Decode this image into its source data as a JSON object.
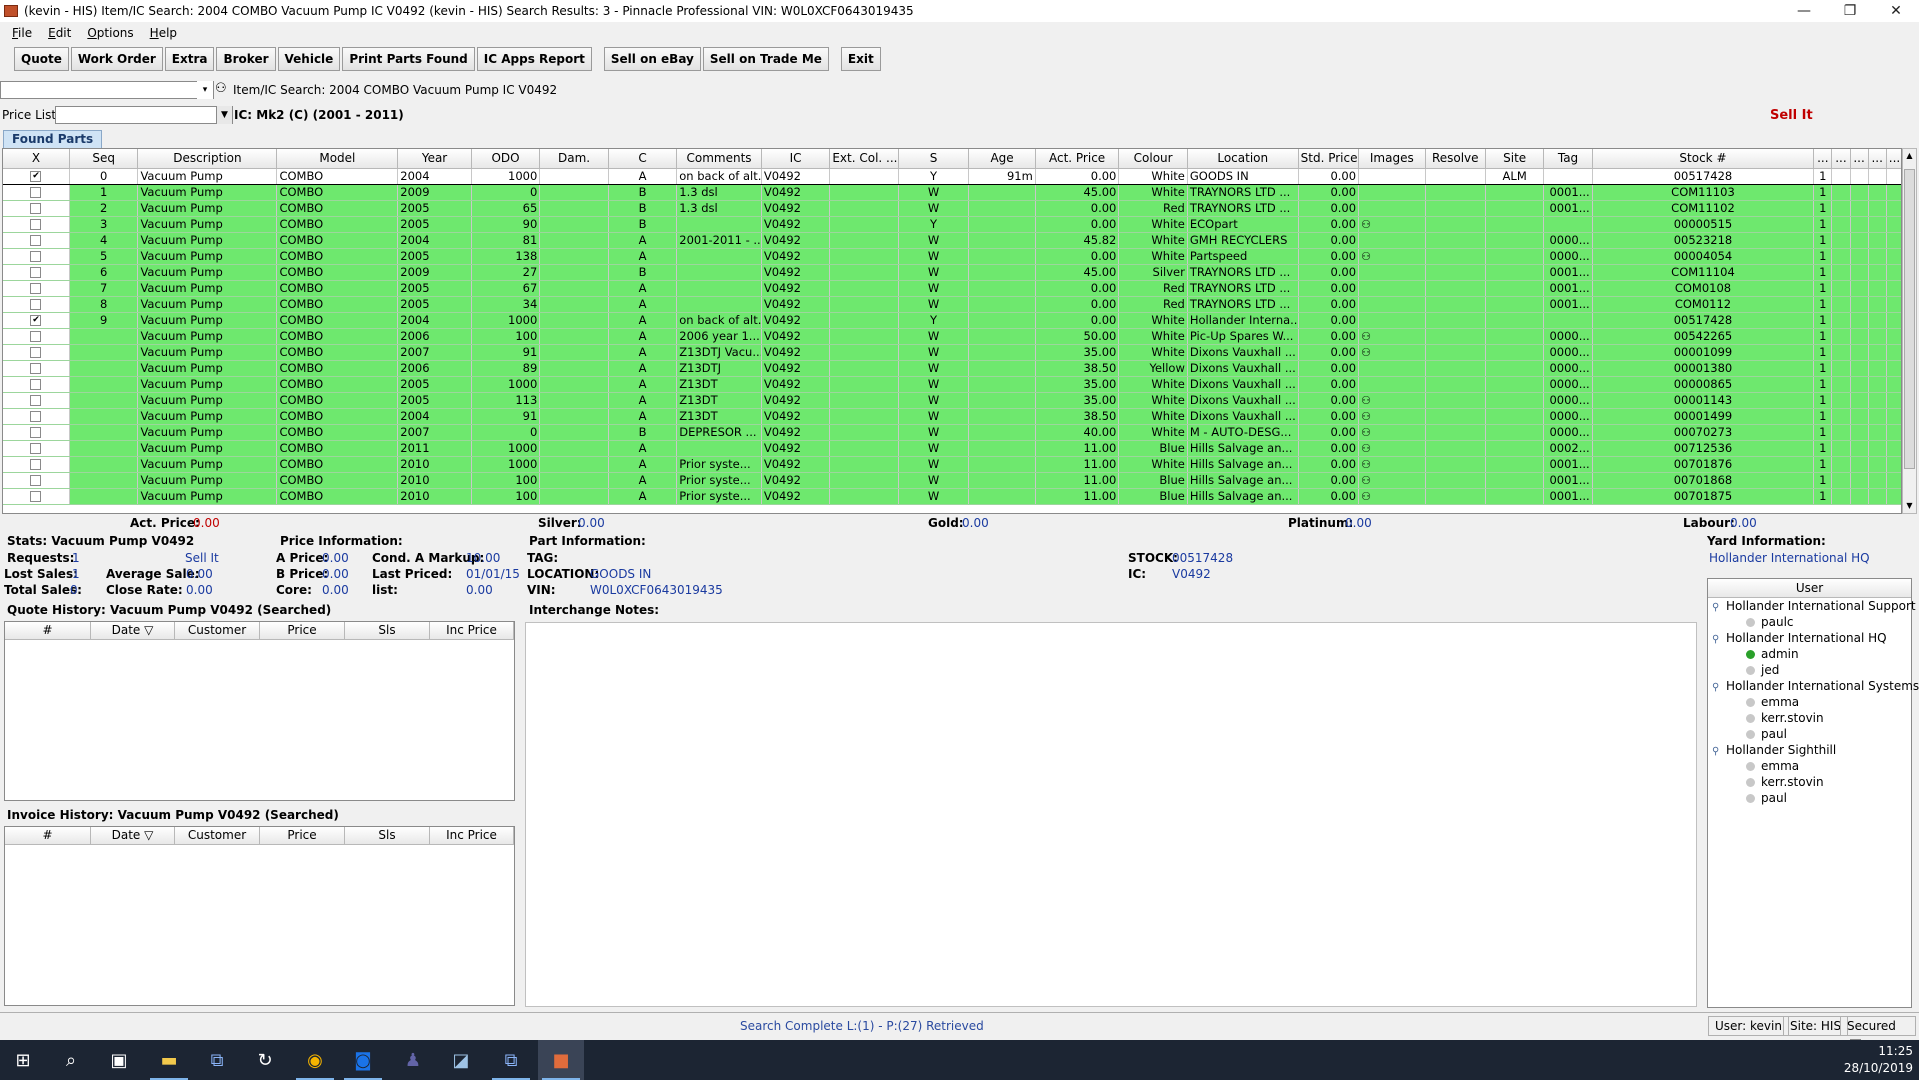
{
  "window": {
    "title": "(kevin - HIS) Item/IC Search: 2004 COMBO Vacuum Pump  IC V0492   (kevin - HIS) Search Results: 3 - Pinnacle Professional VIN: W0L0XCF0643019435",
    "minimize": "—",
    "restore": "❐",
    "close": "✕"
  },
  "menu": [
    "File",
    "Edit",
    "Options",
    "Help"
  ],
  "toolbar": [
    "Quote",
    "Work Order",
    "Extra",
    "Broker",
    "Vehicle",
    "Print Parts Found",
    "IC Apps Report",
    "Sell on eBay",
    "Sell on Trade Me",
    "Exit"
  ],
  "search": {
    "item_ic": "Item/IC Search: 2004 COMBO Vacuum Pump  IC V0492",
    "price_list_label": "Price List",
    "ic_label": "IC: Mk2 (C) (2001 - 2011)",
    "sell_it": "Sell It"
  },
  "tab": "Found Parts",
  "grid": {
    "headers": [
      "X",
      "Seq",
      "Description",
      "Model",
      "Year",
      "ODO",
      "Dam.",
      "C",
      "Comments",
      "IC",
      "Ext. Col. ...",
      "S",
      "Age",
      "Act. Price",
      "Colour",
      "Location",
      "Std. Price",
      "Images",
      "Resolve",
      "Site",
      "Tag",
      "Stock #",
      "...",
      "...",
      "...",
      "...",
      "..."
    ],
    "rows": [
      {
        "chk": true,
        "seq": "0",
        "desc": "Vacuum Pump",
        "model": "COMBO",
        "year": "2004",
        "odo": "1000",
        "c": "A",
        "comm": "on back of alt...",
        "ic": "V0492",
        "s": "Y",
        "age": "91m",
        "price": "0.00",
        "colour": "White",
        "loc": "GOODS IN",
        "std": "0.00",
        "img": false,
        "site": "ALM",
        "tag": "",
        "stock": "00517428",
        "q": "1",
        "sel": true
      },
      {
        "chk": false,
        "seq": "1",
        "desc": "Vacuum Pump",
        "model": "COMBO",
        "year": "2009",
        "odo": "0",
        "c": "B",
        "comm": "1.3 dsl",
        "ic": "V0492",
        "s": "W",
        "age": "",
        "price": "45.00",
        "colour": "White",
        "loc": "TRAYNORS LTD ...",
        "std": "0.00",
        "img": false,
        "site": "",
        "tag": "0001...",
        "stock": "COM11103",
        "q": "1"
      },
      {
        "chk": false,
        "seq": "2",
        "desc": "Vacuum Pump",
        "model": "COMBO",
        "year": "2005",
        "odo": "65",
        "c": "B",
        "comm": "1.3 dsl",
        "ic": "V0492",
        "s": "W",
        "age": "",
        "price": "0.00",
        "colour": "Red",
        "loc": "TRAYNORS LTD ...",
        "std": "0.00",
        "img": false,
        "site": "",
        "tag": "0001...",
        "stock": "COM11102",
        "q": "1"
      },
      {
        "chk": false,
        "seq": "3",
        "desc": "Vacuum Pump",
        "model": "COMBO",
        "year": "2005",
        "odo": "90",
        "c": "B",
        "comm": "",
        "ic": "V0492",
        "s": "Y",
        "age": "",
        "price": "0.00",
        "colour": "White",
        "loc": "ECOpart",
        "std": "0.00",
        "img": true,
        "site": "",
        "tag": "",
        "stock": "00000515",
        "q": "1"
      },
      {
        "chk": false,
        "seq": "4",
        "desc": "Vacuum Pump",
        "model": "COMBO",
        "year": "2004",
        "odo": "81",
        "c": "A",
        "comm": "2001-2011 - ...",
        "ic": "V0492",
        "s": "W",
        "age": "",
        "price": "45.82",
        "colour": "White",
        "loc": "GMH RECYCLERS",
        "std": "0.00",
        "img": false,
        "site": "",
        "tag": "0000...",
        "stock": "00523218",
        "q": "1"
      },
      {
        "chk": false,
        "seq": "5",
        "desc": "Vacuum Pump",
        "model": "COMBO",
        "year": "2005",
        "odo": "138",
        "c": "A",
        "comm": "",
        "ic": "V0492",
        "s": "W",
        "age": "",
        "price": "0.00",
        "colour": "White",
        "loc": "Partspeed",
        "std": "0.00",
        "img": true,
        "site": "",
        "tag": "0000...",
        "stock": "00004054",
        "q": "1"
      },
      {
        "chk": false,
        "seq": "6",
        "desc": "Vacuum Pump",
        "model": "COMBO",
        "year": "2009",
        "odo": "27",
        "c": "B",
        "comm": "",
        "ic": "V0492",
        "s": "W",
        "age": "",
        "price": "45.00",
        "colour": "Silver",
        "loc": "TRAYNORS LTD ...",
        "std": "0.00",
        "img": false,
        "site": "",
        "tag": "0001...",
        "stock": "COM11104",
        "q": "1"
      },
      {
        "chk": false,
        "seq": "7",
        "desc": "Vacuum Pump",
        "model": "COMBO",
        "year": "2005",
        "odo": "67",
        "c": "A",
        "comm": "",
        "ic": "V0492",
        "s": "W",
        "age": "",
        "price": "0.00",
        "colour": "Red",
        "loc": "TRAYNORS LTD ...",
        "std": "0.00",
        "img": false,
        "site": "",
        "tag": "0001...",
        "stock": "COM0108",
        "q": "1"
      },
      {
        "chk": false,
        "seq": "8",
        "desc": "Vacuum Pump",
        "model": "COMBO",
        "year": "2005",
        "odo": "34",
        "c": "A",
        "comm": "",
        "ic": "V0492",
        "s": "W",
        "age": "",
        "price": "0.00",
        "colour": "Red",
        "loc": "TRAYNORS LTD ...",
        "std": "0.00",
        "img": false,
        "site": "",
        "tag": "0001...",
        "stock": "COM0112",
        "q": "1"
      },
      {
        "chk": true,
        "seq": "9",
        "desc": "Vacuum Pump",
        "model": "COMBO",
        "year": "2004",
        "odo": "1000",
        "c": "A",
        "comm": "on back of alt...",
        "ic": "V0492",
        "s": "Y",
        "age": "",
        "price": "0.00",
        "colour": "White",
        "loc": "Hollander Interna...",
        "std": "0.00",
        "img": false,
        "site": "",
        "tag": "",
        "stock": "00517428",
        "q": "1"
      },
      {
        "chk": false,
        "seq": "",
        "desc": "Vacuum Pump",
        "model": "COMBO",
        "year": "2006",
        "odo": "100",
        "c": "A",
        "comm": "2006 year 1....",
        "ic": "V0492",
        "s": "W",
        "age": "",
        "price": "50.00",
        "colour": "White",
        "loc": "Pic-Up Spares W...",
        "std": "0.00",
        "img": true,
        "site": "",
        "tag": "0000...",
        "stock": "00542265",
        "q": "1"
      },
      {
        "chk": false,
        "seq": "",
        "desc": "Vacuum Pump",
        "model": "COMBO",
        "year": "2007",
        "odo": "91",
        "c": "A",
        "comm": "Z13DTJ Vacu...",
        "ic": "V0492",
        "s": "W",
        "age": "",
        "price": "35.00",
        "colour": "White",
        "loc": "Dixons Vauxhall ...",
        "std": "0.00",
        "img": true,
        "site": "",
        "tag": "0000...",
        "stock": "00001099",
        "q": "1"
      },
      {
        "chk": false,
        "seq": "",
        "desc": "Vacuum Pump",
        "model": "COMBO",
        "year": "2006",
        "odo": "89",
        "c": "A",
        "comm": "Z13DTJ",
        "ic": "V0492",
        "s": "W",
        "age": "",
        "price": "38.50",
        "colour": "Yellow",
        "loc": "Dixons Vauxhall ...",
        "std": "0.00",
        "img": false,
        "site": "",
        "tag": "0000...",
        "stock": "00001380",
        "q": "1"
      },
      {
        "chk": false,
        "seq": "",
        "desc": "Vacuum Pump",
        "model": "COMBO",
        "year": "2005",
        "odo": "1000",
        "c": "A",
        "comm": "Z13DT",
        "ic": "V0492",
        "s": "W",
        "age": "",
        "price": "35.00",
        "colour": "White",
        "loc": "Dixons Vauxhall ...",
        "std": "0.00",
        "img": false,
        "site": "",
        "tag": "0000...",
        "stock": "00000865",
        "q": "1"
      },
      {
        "chk": false,
        "seq": "",
        "desc": "Vacuum Pump",
        "model": "COMBO",
        "year": "2005",
        "odo": "113",
        "c": "A",
        "comm": "Z13DT",
        "ic": "V0492",
        "s": "W",
        "age": "",
        "price": "35.00",
        "colour": "White",
        "loc": "Dixons Vauxhall ...",
        "std": "0.00",
        "img": true,
        "site": "",
        "tag": "0000...",
        "stock": "00001143",
        "q": "1"
      },
      {
        "chk": false,
        "seq": "",
        "desc": "Vacuum Pump",
        "model": "COMBO",
        "year": "2004",
        "odo": "91",
        "c": "A",
        "comm": "Z13DT",
        "ic": "V0492",
        "s": "W",
        "age": "",
        "price": "38.50",
        "colour": "White",
        "loc": "Dixons Vauxhall ...",
        "std": "0.00",
        "img": true,
        "site": "",
        "tag": "0000...",
        "stock": "00001499",
        "q": "1"
      },
      {
        "chk": false,
        "seq": "",
        "desc": "Vacuum Pump",
        "model": "COMBO",
        "year": "2007",
        "odo": "0",
        "c": "B",
        "comm": "DEPRESOR ...",
        "ic": "V0492",
        "s": "W",
        "age": "",
        "price": "40.00",
        "colour": "White",
        "loc": "M  - AUTO-DESG...",
        "std": "0.00",
        "img": true,
        "site": "",
        "tag": "0000...",
        "stock": "00070273",
        "q": "1"
      },
      {
        "chk": false,
        "seq": "",
        "desc": "Vacuum Pump",
        "model": "COMBO",
        "year": "2011",
        "odo": "1000",
        "c": "A",
        "comm": "",
        "ic": "V0492",
        "s": "W",
        "age": "",
        "price": "11.00",
        "colour": "Blue",
        "loc": "Hills Salvage an...",
        "std": "0.00",
        "img": true,
        "site": "",
        "tag": "0002...",
        "stock": "00712536",
        "q": "1"
      },
      {
        "chk": false,
        "seq": "",
        "desc": "Vacuum Pump",
        "model": "COMBO",
        "year": "2010",
        "odo": "1000",
        "c": "A",
        "comm": "Prior syste...",
        "ic": "V0492",
        "s": "W",
        "age": "",
        "price": "11.00",
        "colour": "White",
        "loc": "Hills Salvage an...",
        "std": "0.00",
        "img": true,
        "site": "",
        "tag": "0001...",
        "stock": "00701876",
        "q": "1"
      },
      {
        "chk": false,
        "seq": "",
        "desc": "Vacuum Pump",
        "model": "COMBO",
        "year": "2010",
        "odo": "100",
        "c": "A",
        "comm": "Prior syste...",
        "ic": "V0492",
        "s": "W",
        "age": "",
        "price": "11.00",
        "colour": "Blue",
        "loc": "Hills Salvage an...",
        "std": "0.00",
        "img": true,
        "site": "",
        "tag": "0001...",
        "stock": "00701868",
        "q": "1"
      },
      {
        "chk": false,
        "seq": "",
        "desc": "Vacuum Pump",
        "model": "COMBO",
        "year": "2010",
        "odo": "100",
        "c": "A",
        "comm": "Prior syste...",
        "ic": "V0492",
        "s": "W",
        "age": "",
        "price": "11.00",
        "colour": "Blue",
        "loc": "Hills Salvage an...",
        "std": "0.00",
        "img": true,
        "site": "",
        "tag": "0001...",
        "stock": "00701875",
        "q": "1"
      }
    ]
  },
  "prices": {
    "act_label": "Act. Price:",
    "act": "0.00",
    "silver_label": "Silver:",
    "silver": "0.00",
    "gold_label": "Gold:",
    "gold": "0.00",
    "platinum_label": "Platinum:",
    "platinum": "0.00",
    "labour_label": "Labour:",
    "labour": "0.00"
  },
  "stats": {
    "title": "Stats: Vacuum Pump V0492",
    "requests_label": "Requests:",
    "requests": "1",
    "sell_it": "Sell It",
    "lost_label": "Lost Sales:",
    "lost": "1",
    "avg_label": "Average Sale:",
    "avg": "0.00",
    "total_label": "Total Sales:",
    "total": "0",
    "close_label": "Close Rate:",
    "close": "0.00"
  },
  "price_info": {
    "title": "Price Information:",
    "a_label": "A Price:",
    "a": "0.00",
    "cond_label": "Cond. A Markup:",
    "cond": "10.00",
    "b_label": "B Price:",
    "b": "0.00",
    "last_label": "Last Priced:",
    "last": "01/01/15",
    "core_label": "Core:",
    "core": "0.00",
    "list_label": "list:",
    "list": "0.00"
  },
  "part_info": {
    "title": "Part Information:",
    "tag_label": "TAG:",
    "tag": "",
    "loc_label": "LOCATION:",
    "loc": "GOODS IN",
    "vin_label": "VIN:",
    "vin": "W0L0XCF0643019435",
    "stock_label": "STOCK:",
    "stock": "00517428",
    "ic_label": "IC:",
    "ic": "V0492"
  },
  "quote_history": {
    "title": "Quote History: Vacuum Pump V0492 (Searched)",
    "headers": [
      "#",
      "Date ▽",
      "Customer",
      "Price",
      "Sls",
      "Inc Price"
    ]
  },
  "invoice_history": {
    "title": "Invoice History: Vacuum Pump V0492 (Searched)",
    "headers": [
      "#",
      "Date ▽",
      "Customer",
      "Price",
      "Sls",
      "Inc Price"
    ]
  },
  "interchange": {
    "title": "Interchange Notes:"
  },
  "yard": {
    "title": "Yard Information:",
    "selected": "Hollander International HQ",
    "user_header": "User",
    "groups": [
      {
        "name": "Hollander International Support",
        "users": [
          {
            "name": "paulc",
            "online": false
          }
        ]
      },
      {
        "name": "Hollander International HQ",
        "users": [
          {
            "name": "admin",
            "online": true
          },
          {
            "name": "jed",
            "online": false
          }
        ]
      },
      {
        "name": "Hollander International Systems...",
        "users": [
          {
            "name": "emma",
            "online": false
          },
          {
            "name": "kerr.stovin",
            "online": false
          },
          {
            "name": "paul",
            "online": false
          }
        ]
      },
      {
        "name": "Hollander Sighthill",
        "users": [
          {
            "name": "emma",
            "online": false
          },
          {
            "name": "kerr.stovin",
            "online": false
          },
          {
            "name": "paul",
            "online": false
          }
        ]
      }
    ]
  },
  "status": {
    "text": "Search Complete L:(1) - P:(27) Retrieved",
    "user": "User: kevin",
    "site": "Site: HIS",
    "secured": "Secured"
  },
  "clock": {
    "time": "11:25",
    "date": "28/10/2019"
  },
  "colors": {
    "row_green": "#6ee86e",
    "accent_blue": "#1a3aa0",
    "red": "#c00000"
  }
}
